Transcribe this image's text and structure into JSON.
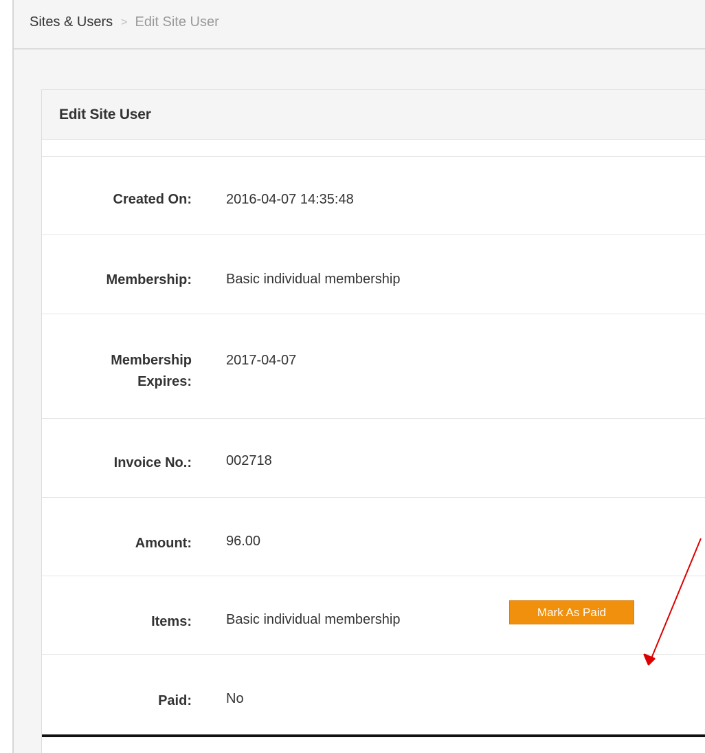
{
  "breadcrumb": {
    "root": "Sites & Users",
    "separator": ">",
    "current": "Edit Site User"
  },
  "panel": {
    "title": "Edit Site User"
  },
  "fields": {
    "created_on": {
      "label": "Created On:",
      "value": "2016-04-07 14:35:48"
    },
    "membership": {
      "label": "Membership:",
      "value": "Basic individual membership"
    },
    "membership_expires": {
      "label_line1": "Membership",
      "label_line2": "Expires:",
      "value": "2017-04-07"
    },
    "invoice_no": {
      "label": "Invoice No.:",
      "value": "002718"
    },
    "amount": {
      "label": "Amount:",
      "value": "96.00"
    },
    "items": {
      "label": "Items:",
      "value": "Basic individual membership"
    },
    "paid": {
      "label": "Paid:",
      "value": "No"
    }
  },
  "actions": {
    "mark_paid_label": "Mark As Paid"
  },
  "colors": {
    "accent_button": "#f0900c",
    "annotation_arrow": "#dd0000"
  },
  "annotation": {
    "icon": "red-arrow-icon"
  }
}
